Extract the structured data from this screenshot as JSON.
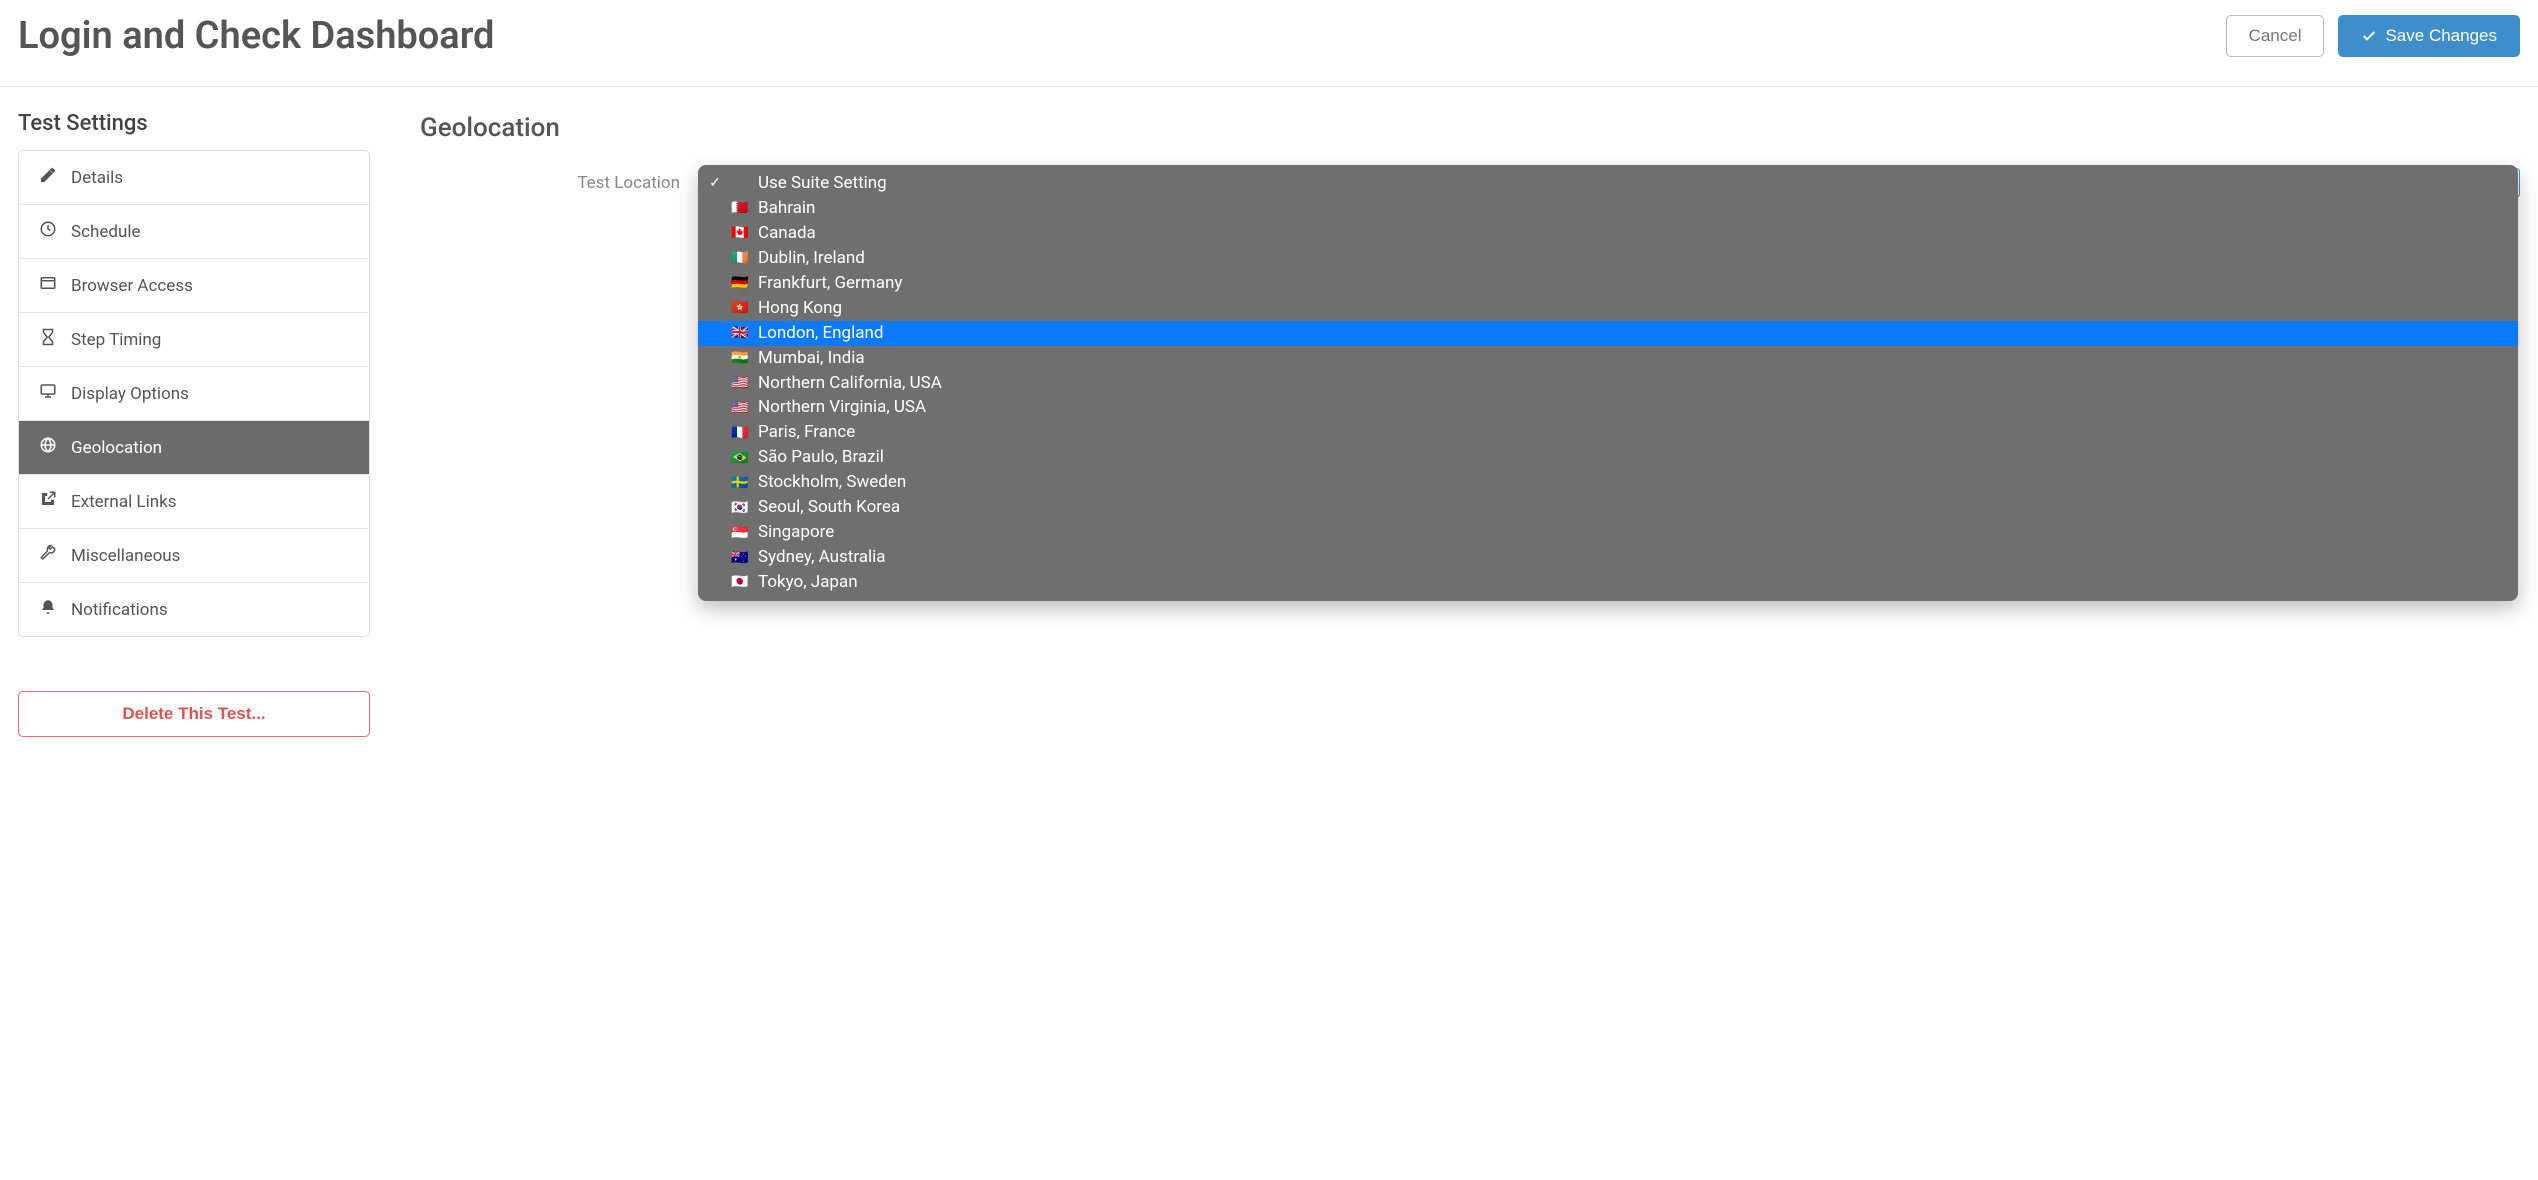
{
  "header": {
    "title": "Login and Check Dashboard",
    "cancel_label": "Cancel",
    "save_label": "Save Changes"
  },
  "sidebar": {
    "title": "Test Settings",
    "items": [
      {
        "label": "Details",
        "icon": "pencil",
        "active": false
      },
      {
        "label": "Schedule",
        "icon": "clock",
        "active": false
      },
      {
        "label": "Browser Access",
        "icon": "window",
        "active": false
      },
      {
        "label": "Step Timing",
        "icon": "hourglass",
        "active": false
      },
      {
        "label": "Display Options",
        "icon": "monitor",
        "active": false
      },
      {
        "label": "Geolocation",
        "icon": "globe",
        "active": true
      },
      {
        "label": "External Links",
        "icon": "external",
        "active": false
      },
      {
        "label": "Miscellaneous",
        "icon": "wrench",
        "active": false
      },
      {
        "label": "Notifications",
        "icon": "bell",
        "active": false
      }
    ],
    "delete_label": "Delete This Test..."
  },
  "main": {
    "section_title": "Geolocation",
    "form_label": "Test Location",
    "dropdown": {
      "options": [
        {
          "label": "Use Suite Setting",
          "flag": "",
          "checked": true,
          "highlighted": false
        },
        {
          "label": "Bahrain",
          "flag": "🇧🇭",
          "checked": false,
          "highlighted": false
        },
        {
          "label": "Canada",
          "flag": "🇨🇦",
          "checked": false,
          "highlighted": false
        },
        {
          "label": "Dublin, Ireland",
          "flag": "🇮🇪",
          "checked": false,
          "highlighted": false
        },
        {
          "label": "Frankfurt, Germany",
          "flag": "🇩🇪",
          "checked": false,
          "highlighted": false
        },
        {
          "label": "Hong Kong",
          "flag": "🇭🇰",
          "checked": false,
          "highlighted": false
        },
        {
          "label": "London, England",
          "flag": "🇬🇧",
          "checked": false,
          "highlighted": true
        },
        {
          "label": "Mumbai, India",
          "flag": "🇮🇳",
          "checked": false,
          "highlighted": false
        },
        {
          "label": "Northern California, USA",
          "flag": "🇺🇸",
          "checked": false,
          "highlighted": false
        },
        {
          "label": "Northern Virginia, USA",
          "flag": "🇺🇸",
          "checked": false,
          "highlighted": false
        },
        {
          "label": "Paris, France",
          "flag": "🇫🇷",
          "checked": false,
          "highlighted": false
        },
        {
          "label": "São Paulo, Brazil",
          "flag": "🇧🇷",
          "checked": false,
          "highlighted": false
        },
        {
          "label": "Stockholm, Sweden",
          "flag": "🇸🇪",
          "checked": false,
          "highlighted": false
        },
        {
          "label": "Seoul, South Korea",
          "flag": "🇰🇷",
          "checked": false,
          "highlighted": false
        },
        {
          "label": "Singapore",
          "flag": "🇸🇬",
          "checked": false,
          "highlighted": false
        },
        {
          "label": "Sydney, Australia",
          "flag": "🇦🇺",
          "checked": false,
          "highlighted": false
        },
        {
          "label": "Tokyo, Japan",
          "flag": "🇯🇵",
          "checked": false,
          "highlighted": false
        }
      ]
    }
  }
}
